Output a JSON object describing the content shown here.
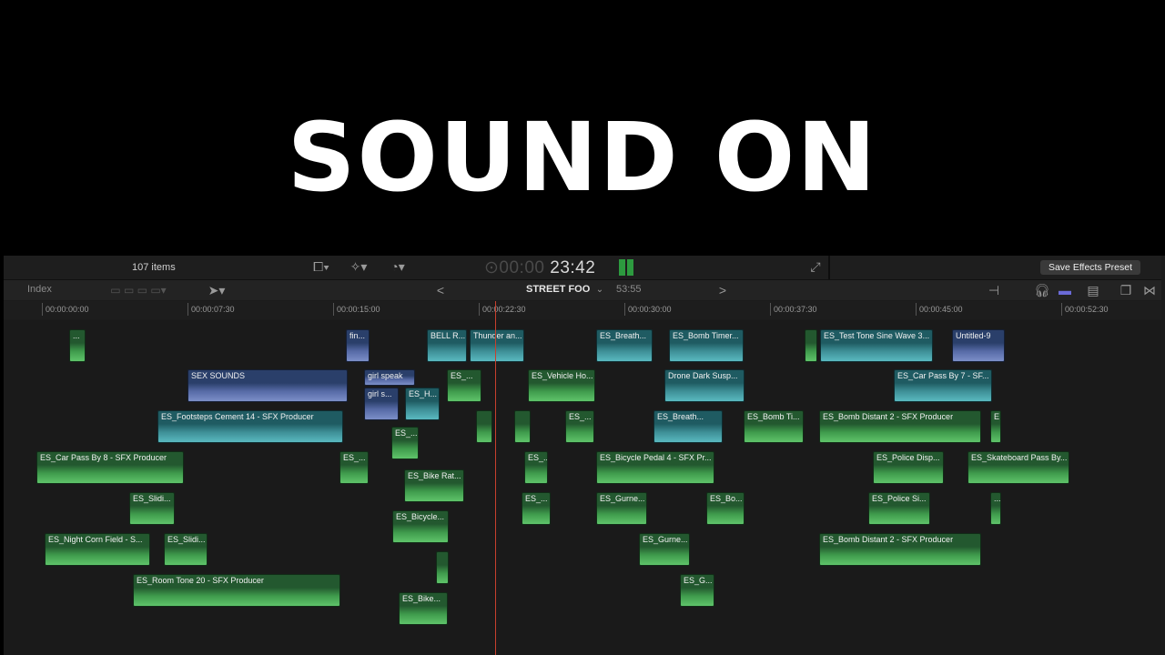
{
  "overlay": {
    "title": "SOUND ON"
  },
  "toolbar": {
    "items_count": "107 items",
    "timecode_dim": "00:00",
    "timecode": "23:42",
    "save_effects_preset": "Save Effects Preset"
  },
  "timeline_header": {
    "index": "Index",
    "project": "STREET FOO",
    "duration": "53:55",
    "prev": "<",
    "next": ">"
  },
  "ruler": [
    "00:00:00:00",
    "00:00:07:30",
    "00:00:15:00",
    "00:00:22:30",
    "00:00:30:00",
    "00:00:37:30",
    "00:00:45:00",
    "00:00:52:30"
  ],
  "clips": [
    {
      "label": "...",
      "color": "green"
    },
    {
      "label": "fin...",
      "color": "blue"
    },
    {
      "label": "BELL R...",
      "color": "teal"
    },
    {
      "label": "Thunder an...",
      "color": "teal"
    },
    {
      "label": "ES_Breath...",
      "color": "teal"
    },
    {
      "label": "ES_Bomb Timer...",
      "color": "teal"
    },
    {
      "label": "",
      "color": "green"
    },
    {
      "label": "ES_Test Tone Sine Wave 3...",
      "color": "teal"
    },
    {
      "label": "Untitled-9",
      "color": "blue"
    },
    {
      "label": "SEX SOUNDS",
      "color": "blue"
    },
    {
      "label": "girl speak",
      "color": "blue"
    },
    {
      "label": "ES_...",
      "color": "green"
    },
    {
      "label": "ES_Vehicle Ho...",
      "color": "green"
    },
    {
      "label": "Drone Dark Susp...",
      "color": "teal"
    },
    {
      "label": "ES_Car Pass By 7 - SF...",
      "color": "teal"
    },
    {
      "label": "girl s...",
      "color": "blue"
    },
    {
      "label": "ES_H...",
      "color": "teal"
    },
    {
      "label": "ES_Footsteps Cement 14 - SFX Producer",
      "color": "teal"
    },
    {
      "label": "",
      "color": "green"
    },
    {
      "label": "",
      "color": "green"
    },
    {
      "label": "ES_...",
      "color": "green"
    },
    {
      "label": "ES_Breath...",
      "color": "teal"
    },
    {
      "label": "ES_Bomb Ti...",
      "color": "green"
    },
    {
      "label": "ES_Bomb Distant 2 - SFX Producer",
      "color": "green"
    },
    {
      "label": "E",
      "color": "green"
    },
    {
      "label": "ES_...",
      "color": "green"
    },
    {
      "label": "ES_Car Pass By 8 - SFX Producer",
      "color": "green"
    },
    {
      "label": "ES_...",
      "color": "green"
    },
    {
      "label": "ES_...",
      "color": "green"
    },
    {
      "label": "ES_Bicycle Pedal 4 - SFX Pr...",
      "color": "green"
    },
    {
      "label": "ES_Police Disp...",
      "color": "green"
    },
    {
      "label": "ES_Skateboard Pass By...",
      "color": "green"
    },
    {
      "label": "ES_Bike Rat...",
      "color": "green"
    },
    {
      "label": "ES_Slidi...",
      "color": "green"
    },
    {
      "label": "ES_...",
      "color": "green"
    },
    {
      "label": "ES_Gurne...",
      "color": "green"
    },
    {
      "label": "ES_Bo...",
      "color": "green"
    },
    {
      "label": "ES_Police Si...",
      "color": "green"
    },
    {
      "label": "...",
      "color": "green"
    },
    {
      "label": "ES_Bicycle...",
      "color": "green"
    },
    {
      "label": "ES_Night Corn Field - S...",
      "color": "green"
    },
    {
      "label": "ES_Slidi...",
      "color": "green"
    },
    {
      "label": "ES_Gurne...",
      "color": "green"
    },
    {
      "label": "ES_Bomb Distant 2 - SFX Producer",
      "color": "green"
    },
    {
      "label": "",
      "color": "green"
    },
    {
      "label": "ES_Room Tone 20 - SFX Producer",
      "color": "green"
    },
    {
      "label": "ES_G...",
      "color": "green"
    },
    {
      "label": "ES_Bike...",
      "color": "green"
    }
  ]
}
